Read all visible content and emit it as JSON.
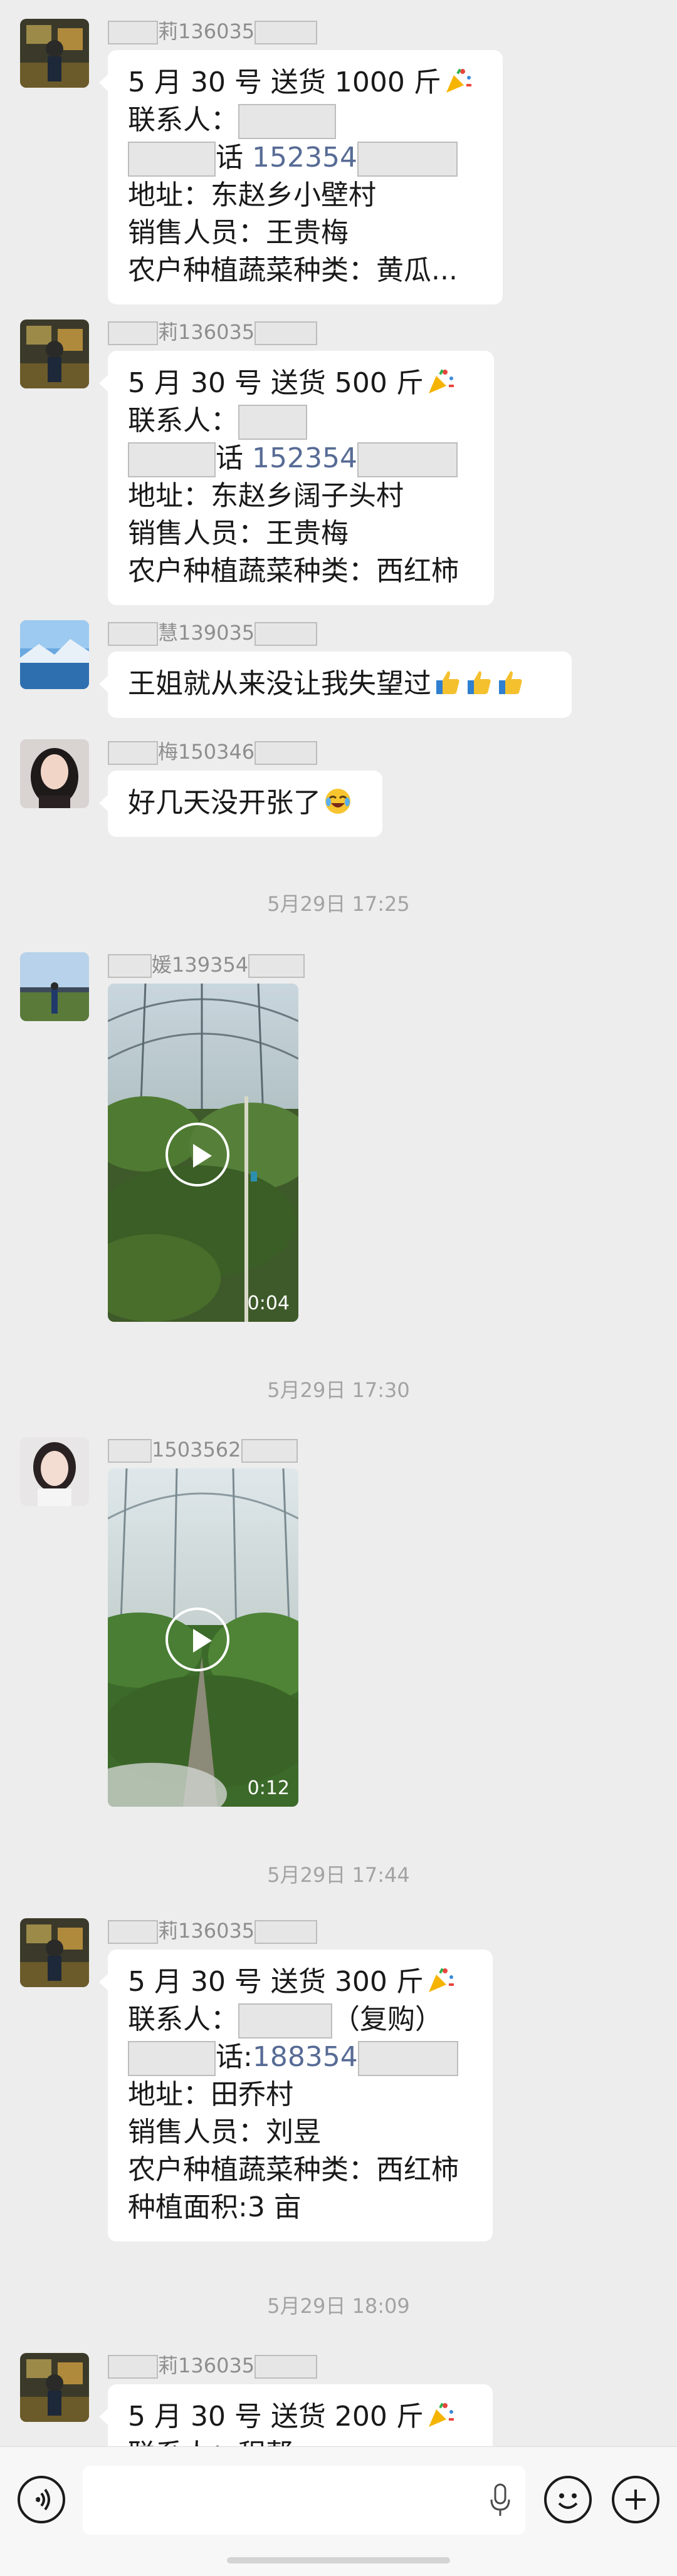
{
  "messages": [
    {
      "sender_visible": "莉136035",
      "lines": [
        {
          "text": "5 月 30 号  送货   1000 斤",
          "emoji": "party-popper"
        },
        {
          "label": "联系人：",
          "redacted": true
        },
        {
          "label": "话 ",
          "phone": "152354",
          "redacted_prefix": true,
          "redacted": true
        },
        {
          "text": "地址：东赵乡小壁村"
        },
        {
          "text": "销售人员：王贵梅"
        },
        {
          "text": "农户种植蔬菜种类：黄瓜..."
        }
      ]
    },
    {
      "sender_visible": "莉136035",
      "lines": [
        {
          "text": "5 月 30 号  送货   500 斤",
          "emoji": "party-popper"
        },
        {
          "label": "联系人：",
          "redacted": true
        },
        {
          "label": "话 ",
          "phone": "152354",
          "redacted_prefix": true,
          "redacted": true
        },
        {
          "text": "地址：东赵乡阔子头村"
        },
        {
          "text": "销售人员：王贵梅"
        },
        {
          "text": "农户种植蔬菜种类：西红柿"
        }
      ]
    },
    {
      "sender_visible": "慧139035",
      "text": "王姐就从来没让我失望过",
      "emoji": "thumbs-up x3"
    },
    {
      "sender_visible": "梅150346",
      "text": "好几天没开张了",
      "emoji": "crying-laughing"
    },
    {
      "timestamp": "5月29日 17:25"
    },
    {
      "sender_visible": "媛139354",
      "video_duration": "0:04"
    },
    {
      "timestamp": "5月29日 17:30"
    },
    {
      "sender_visible": "1503562",
      "video_duration": "0:12"
    },
    {
      "timestamp": "5月29日 17:44"
    },
    {
      "sender_visible": "莉136035",
      "lines": [
        {
          "text": "5 月 30 号  送货   300 斤",
          "emoji": "party-popper"
        },
        {
          "label": "联系人：",
          "redacted": true,
          "suffix": "（复购）"
        },
        {
          "label": "话:",
          "phone": "188354",
          "redacted_prefix": true,
          "redacted": true
        },
        {
          "text": "地址：田乔村"
        },
        {
          "text": "销售人员：刘昱"
        },
        {
          "text": "农户种植蔬菜种类：西红柿"
        },
        {
          "text": "种植面积:3 亩"
        }
      ]
    },
    {
      "timestamp": "5月29日 18:09"
    },
    {
      "sender_visible": "莉136035",
      "lines": [
        {
          "text": "5 月 30 号  送货   200 斤",
          "emoji": "party-popper"
        },
        {
          "text": "联系人：程帮"
        }
      ]
    }
  ],
  "input_bar": {
    "voice_icon": "voice-icon",
    "mic_icon": "mic-icon",
    "emoji_icon": "smiley-icon",
    "plus_icon": "plus-icon"
  },
  "colors": {
    "background": "#ededed",
    "bubble": "#ffffff",
    "link": "#576b95",
    "timestamp": "#a3a3a3"
  }
}
